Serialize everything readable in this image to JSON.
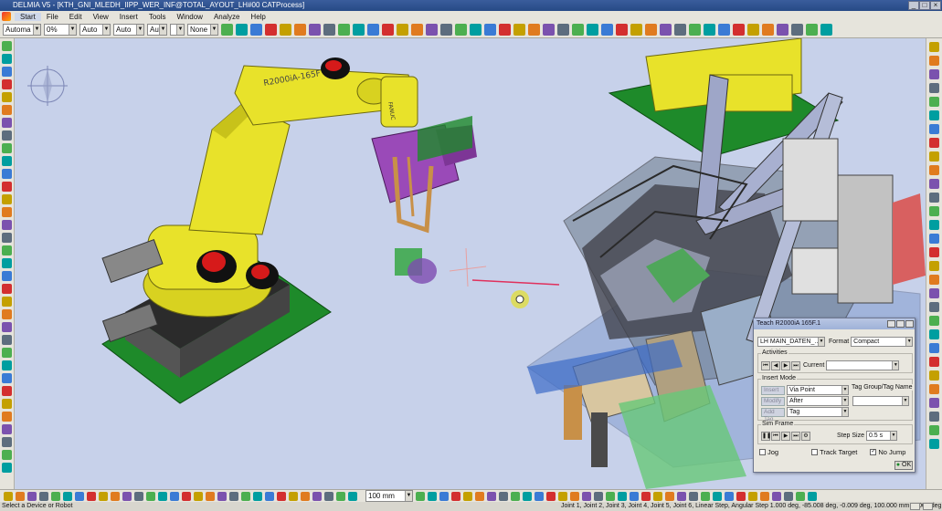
{
  "window": {
    "title": "DELMIA V5 - [KTH_GNI_MLEDH_IIPP_WER_INF@TOTAL_AYOUT_LH#00 CATProcess]"
  },
  "menu": {
    "items": [
      "Start",
      "File",
      "Edit",
      "View",
      "Insert",
      "Tools",
      "Window",
      "Analyze",
      "Help"
    ]
  },
  "toolbar": {
    "combos": [
      {
        "value": "Automa",
        "w": 42
      },
      {
        "value": "0%",
        "w": 36
      },
      {
        "value": "Auto",
        "w": 34
      },
      {
        "value": "Auto",
        "w": 34
      },
      {
        "value": "Aut",
        "w": 22
      },
      {
        "value": "",
        "w": 16
      },
      {
        "value": "None",
        "w": 34
      }
    ]
  },
  "viewport": {
    "robot_label": "R2000iA-165F",
    "robot_brand": "FANUC"
  },
  "teach_dialog": {
    "title": "Teach R2000iA 165F.1",
    "controller": "LH MAIN_DATEN_...",
    "format_label": "Format",
    "format_value": "Compact",
    "activities_label": "Activities",
    "current_label": "Current",
    "insert_mode_label": "Insert Mode",
    "insert_rows": [
      {
        "button": "Insert",
        "value": "Via Point"
      },
      {
        "button": "Modify",
        "value": "After"
      },
      {
        "button": "Add Tag",
        "value": "Tag"
      }
    ],
    "tag_group_label": "Tag Group/Tag Name",
    "sim_frame_label": "Sim Frame",
    "step_size_label": "Step Size",
    "step_size_value": "0.5 s",
    "jog_label": "Jog",
    "track_target_label": "Track Target",
    "no_jump_label": "No Jump",
    "ok_label": "OK"
  },
  "bottom_toolbar": {
    "length_value": "100 mm"
  },
  "status": {
    "left": "Select a Device or Robot",
    "right": "Joint 1, Joint 2, Joint 3, Joint 4, Joint 5, Joint 6, Linear Step, Angular Step  1.000 deg, -85.008 deg, -0.009 deg, 100.000 mm, 1.000 deg"
  },
  "colors": {
    "robot": "#e8e22a",
    "viewport_bg": "#c7d1ea",
    "title_bar": "#274a86"
  }
}
